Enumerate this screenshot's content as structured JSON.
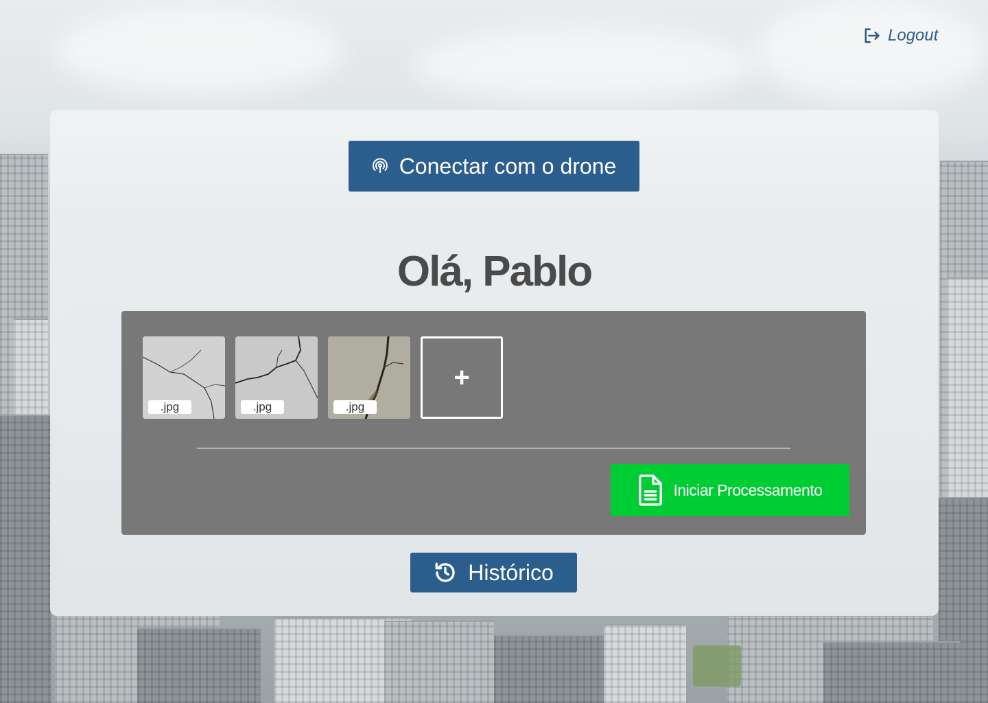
{
  "header": {
    "logout_label": "Logout",
    "logout_icon": "logout-icon"
  },
  "main": {
    "connect_button": {
      "label": "Conectar com o drone",
      "icon": "broadcast-icon"
    },
    "greeting": "Olá, Pablo",
    "uploads": [
      {
        "tag": ".jpg"
      },
      {
        "tag": ".jpg"
      },
      {
        "tag": ".jpg"
      }
    ],
    "add_button_label": "+",
    "process_button": {
      "label": "Iniciar Processamento",
      "icon": "document-icon"
    },
    "history_button": {
      "label": "Histórico",
      "icon": "history-icon"
    }
  },
  "colors": {
    "primary": "#2b5d8d",
    "success": "#00cc33",
    "upload_bg": "#787878",
    "greeting_text": "#4a4a4a"
  }
}
